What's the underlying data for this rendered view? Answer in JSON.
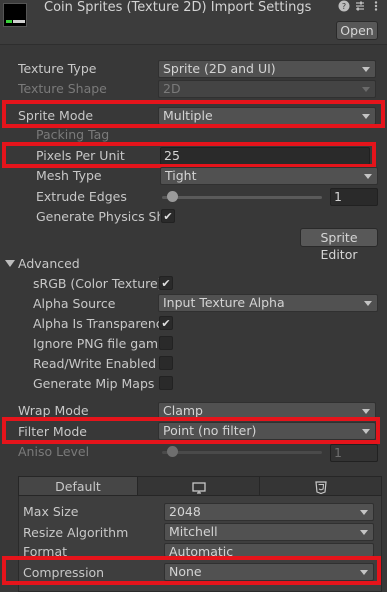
{
  "header": {
    "title": "Coin Sprites (Texture 2D) Import Settings",
    "open_label": "Open",
    "icons": [
      "help-icon",
      "preset-icon",
      "kebab-menu-icon"
    ]
  },
  "texture": {
    "texture_type_label": "Texture Type",
    "texture_type_value": "Sprite (2D and UI)",
    "texture_shape_label": "Texture Shape",
    "texture_shape_value": "2D"
  },
  "sprite": {
    "sprite_mode_label": "Sprite Mode",
    "sprite_mode_value": "Multiple",
    "packing_tag_label": "Packing Tag",
    "ppu_label": "Pixels Per Unit",
    "ppu_value": "25",
    "mesh_type_label": "Mesh Type",
    "mesh_type_value": "Tight",
    "extrude_label": "Extrude Edges",
    "extrude_value": "1",
    "extrude_fraction": 0.03,
    "gen_physics_label": "Generate Physics Sha",
    "gen_physics_checked": true,
    "sprite_editor_label": "Sprite Editor"
  },
  "advanced": {
    "section_label": "Advanced",
    "srgb_label": "sRGB (Color Texture)",
    "srgb_checked": true,
    "alpha_source_label": "Alpha Source",
    "alpha_source_value": "Input Texture Alpha",
    "alpha_transparency_label": "Alpha Is Transparency",
    "alpha_transparency_checked": true,
    "ignore_png_label": "Ignore PNG file gamma",
    "ignore_png_checked": false,
    "read_write_label": "Read/Write Enabled",
    "read_write_checked": false,
    "mipmaps_label": "Generate Mip Maps",
    "mipmaps_checked": false
  },
  "sampling": {
    "wrap_mode_label": "Wrap Mode",
    "wrap_mode_value": "Clamp",
    "filter_mode_label": "Filter Mode",
    "filter_mode_value": "Point (no filter)",
    "aniso_label": "Aniso Level",
    "aniso_value": "1",
    "aniso_fraction": 0.03
  },
  "platform": {
    "tab_default": "Default",
    "tab_icons": [
      "monitor-icon",
      "html5-icon"
    ],
    "max_size_label": "Max Size",
    "max_size_value": "2048",
    "resize_label": "Resize Algorithm",
    "resize_value": "Mitchell",
    "format_label": "Format",
    "format_value": "Automatic",
    "compression_label": "Compression",
    "compression_value": "None"
  },
  "colors": {
    "highlight": "#e5141b",
    "background": "#383838"
  }
}
